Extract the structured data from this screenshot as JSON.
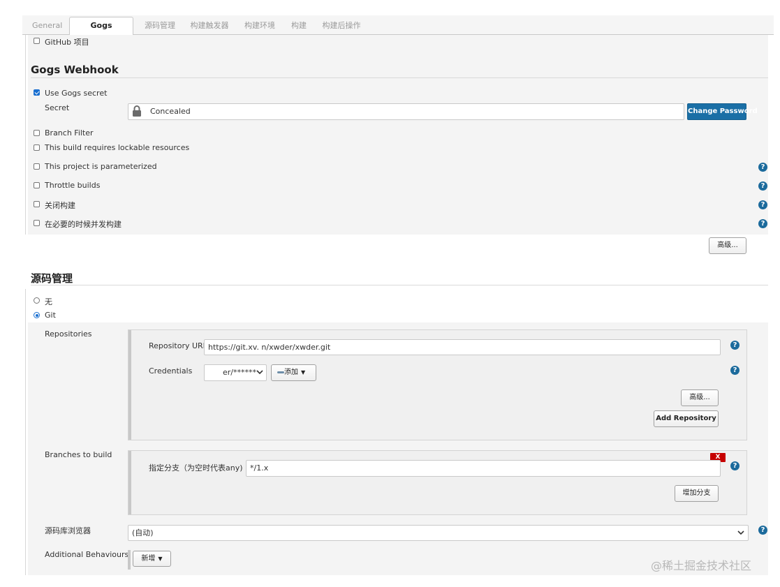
{
  "tabs": [
    "General",
    "Gogs Webhook",
    "源码管理",
    "构建触发器",
    "构建环境",
    "构建",
    "构建后操作"
  ],
  "active_tab": "Gogs Webhook",
  "general": {
    "github_project_label": "GitHub 项目"
  },
  "gogs_webhook": {
    "title": "Gogs Webhook",
    "use_secret_label": "Use Gogs secret",
    "use_secret_checked": true,
    "secret_label": "Secret",
    "secret_value": "Concealed",
    "change_password_label": "Change Password",
    "branch_filter_label": "Branch Filter",
    "lockable_label": "This build requires lockable resources",
    "parameterized_label": "This project is parameterized",
    "throttle_label": "Throttle builds",
    "disable_label": "关闭构建",
    "concurrent_label": "在必要的时候并发构建",
    "advanced_label": "高级..."
  },
  "scm": {
    "title": "源码管理",
    "none_label": "无",
    "git_label": "Git",
    "selected": "Git",
    "repositories_label": "Repositories",
    "repo_url_label": "Repository URL",
    "repo_url_value": "https://git.xv.            n/xwder/xwder.git",
    "credentials_label": "Credentials",
    "credentials_value": "er/******",
    "add_label": "添加",
    "advanced_label": "高级...",
    "add_repository_label": "Add Repository",
    "branches_label": "Branches to build",
    "branch_spec_label": "指定分支（为空时代表any)",
    "branch_spec_value": "*/1.x",
    "delete_label": "X",
    "add_branch_label": "增加分支",
    "browser_label": "源码库浏览器",
    "browser_value": "(自动)",
    "behaviours_label": "Additional Behaviours",
    "new_label": "新增"
  },
  "watermark": "@稀土掘金技术社区",
  "colors": {
    "primary": "#1a6fa6",
    "help": "#1b6a9c",
    "danger": "#c60000",
    "checkbox": "#1a6fd0"
  }
}
